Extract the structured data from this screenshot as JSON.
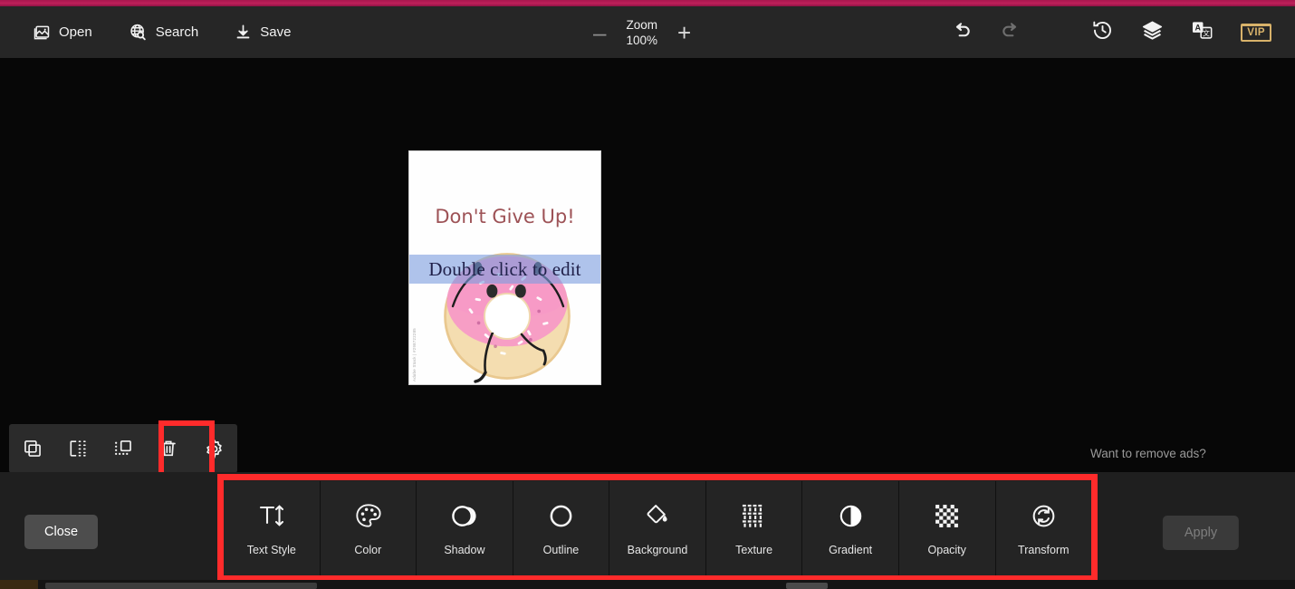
{
  "app": {
    "accent_magenta": "#bd2059",
    "highlight_red": "#ff2b2b",
    "panel_bg": "#1f1f1f",
    "stage_bg": "#070707"
  },
  "topbar": {
    "items": [
      {
        "label": "Open",
        "icon": "image-open-icon"
      },
      {
        "label": "Search",
        "icon": "globe-search-icon"
      },
      {
        "label": "Save",
        "icon": "download-save-icon"
      }
    ],
    "zoom": {
      "minus_label": "–",
      "plus_label": "+",
      "title": "Zoom",
      "value": "100%"
    },
    "right_icons": [
      {
        "name": "undo-icon",
        "label": "Undo",
        "enabled": true
      },
      {
        "name": "redo-icon",
        "label": "Redo",
        "enabled": false
      },
      {
        "name": "history-icon",
        "label": "History",
        "enabled": true
      },
      {
        "name": "layers-icon",
        "label": "Layers",
        "enabled": true
      },
      {
        "name": "translate-icon",
        "label": "Translate",
        "enabled": true
      }
    ],
    "vip_label": "VIP"
  },
  "canvas": {
    "headline_text": "Don't Give Up!",
    "headline_color": "#9d5256",
    "watermark_text": "Adobe Stock | #298722285",
    "selected_layer_text": "Double click to edit",
    "selection_highlight_color": "#7e9ede",
    "donut_icing_color": "#f49ac4",
    "donut_dough_color": "#f2d9a0"
  },
  "ads": {
    "remove_ads_label": "Want to remove ads?"
  },
  "object_toolbar": {
    "buttons": [
      {
        "name": "duplicate-icon",
        "label": "Duplicate"
      },
      {
        "name": "flip-horizontal-icon",
        "label": "Flip"
      },
      {
        "name": "bring-to-front-icon",
        "label": "Arrange"
      },
      {
        "name": "delete-icon",
        "label": "Delete"
      },
      {
        "name": "gear-icon",
        "label": "Customize"
      }
    ],
    "tooltip_label": "Customize"
  },
  "bottom_panel": {
    "close_label": "Close",
    "apply_label": "Apply",
    "tools": [
      {
        "label": "Text Style",
        "icon": "text-size-icon"
      },
      {
        "label": "Color",
        "icon": "palette-icon"
      },
      {
        "label": "Shadow",
        "icon": "shadow-circle-icon"
      },
      {
        "label": "Outline",
        "icon": "outline-circle-icon"
      },
      {
        "label": "Background",
        "icon": "paint-bucket-icon"
      },
      {
        "label": "Texture",
        "icon": "texture-grid-icon"
      },
      {
        "label": "Gradient",
        "icon": "contrast-circle-icon"
      },
      {
        "label": "Opacity",
        "icon": "checker-icon"
      },
      {
        "label": "Transform",
        "icon": "transform-refresh-icon"
      }
    ]
  }
}
